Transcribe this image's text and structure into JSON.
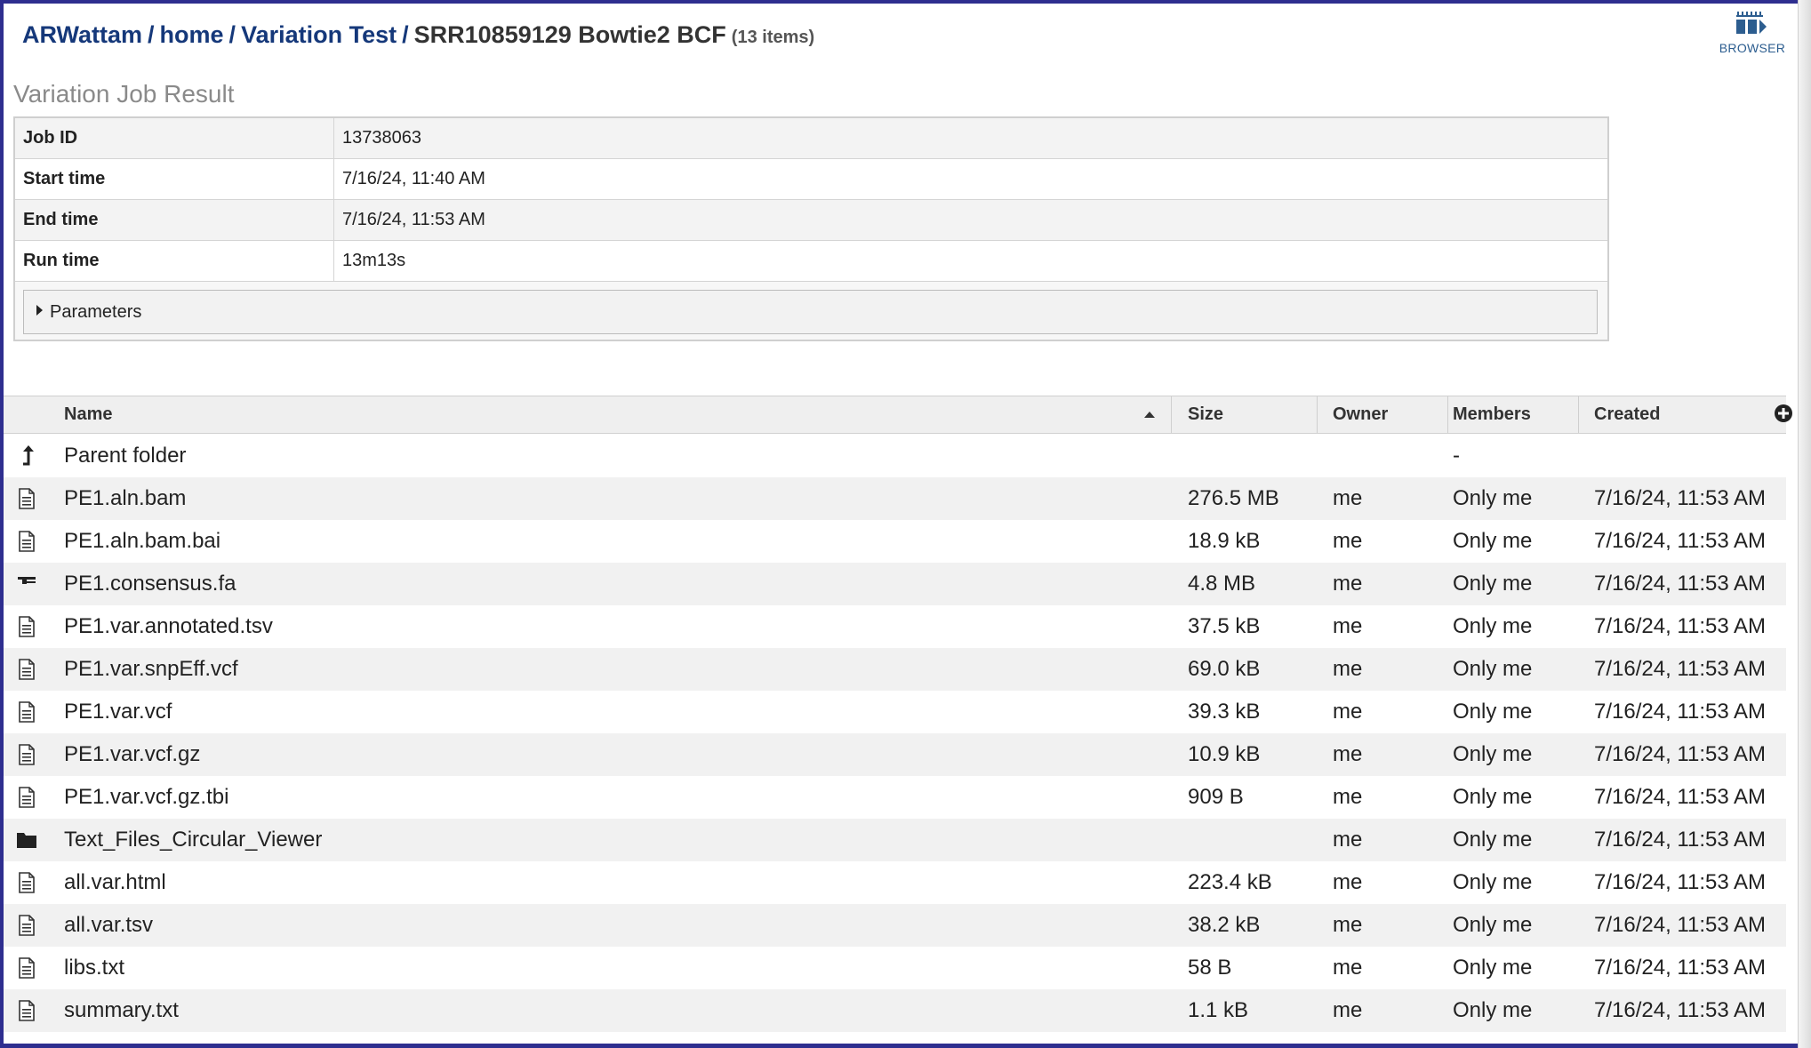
{
  "breadcrumb": {
    "items": [
      "ARWattam",
      "home",
      "Variation Test"
    ],
    "separator": "/",
    "current": "SRR10859129 Bowtie2 BCF",
    "count": "(13 items)"
  },
  "browser_button": {
    "label": "BROWSER",
    "icon": "genome-browser-icon"
  },
  "section_title": "Variation Job Result",
  "job": {
    "rows": [
      {
        "key": "Job ID",
        "value": "13738063"
      },
      {
        "key": "Start time",
        "value": "7/16/24, 11:40 AM"
      },
      {
        "key": "End time",
        "value": "7/16/24, 11:53 AM"
      },
      {
        "key": "Run time",
        "value": "13m13s"
      }
    ],
    "parameters_label": "Parameters"
  },
  "grid": {
    "columns": {
      "name": "Name",
      "size": "Size",
      "owner": "Owner",
      "members": "Members",
      "created": "Created"
    },
    "sort": {
      "column": "Name",
      "direction": "ascending"
    },
    "parent": {
      "name": "Parent folder",
      "members": "-",
      "icon": "parent-folder-icon"
    },
    "files": [
      {
        "icon": "file-icon",
        "name": "PE1.aln.bam",
        "size": "276.5 MB",
        "owner": "me",
        "members": "Only me",
        "created": "7/16/24, 11:53 AM"
      },
      {
        "icon": "file-icon",
        "name": "PE1.aln.bam.bai",
        "size": "18.9 kB",
        "owner": "me",
        "members": "Only me",
        "created": "7/16/24, 11:53 AM"
      },
      {
        "icon": "contigs-icon",
        "name": "PE1.consensus.fa",
        "size": "4.8 MB",
        "owner": "me",
        "members": "Only me",
        "created": "7/16/24, 11:53 AM"
      },
      {
        "icon": "file-icon",
        "name": "PE1.var.annotated.tsv",
        "size": "37.5 kB",
        "owner": "me",
        "members": "Only me",
        "created": "7/16/24, 11:53 AM"
      },
      {
        "icon": "file-icon",
        "name": "PE1.var.snpEff.vcf",
        "size": "69.0 kB",
        "owner": "me",
        "members": "Only me",
        "created": "7/16/24, 11:53 AM"
      },
      {
        "icon": "file-icon",
        "name": "PE1.var.vcf",
        "size": "39.3 kB",
        "owner": "me",
        "members": "Only me",
        "created": "7/16/24, 11:53 AM"
      },
      {
        "icon": "file-icon",
        "name": "PE1.var.vcf.gz",
        "size": "10.9 kB",
        "owner": "me",
        "members": "Only me",
        "created": "7/16/24, 11:53 AM"
      },
      {
        "icon": "file-icon",
        "name": "PE1.var.vcf.gz.tbi",
        "size": "909 B",
        "owner": "me",
        "members": "Only me",
        "created": "7/16/24, 11:53 AM"
      },
      {
        "icon": "folder-icon",
        "name": "Text_Files_Circular_Viewer",
        "size": "",
        "owner": "me",
        "members": "Only me",
        "created": "7/16/24, 11:53 AM"
      },
      {
        "icon": "file-icon",
        "name": "all.var.html",
        "size": "223.4 kB",
        "owner": "me",
        "members": "Only me",
        "created": "7/16/24, 11:53 AM"
      },
      {
        "icon": "file-icon",
        "name": "all.var.tsv",
        "size": "38.2 kB",
        "owner": "me",
        "members": "Only me",
        "created": "7/16/24, 11:53 AM"
      },
      {
        "icon": "file-icon",
        "name": "libs.txt",
        "size": "58 B",
        "owner": "me",
        "members": "Only me",
        "created": "7/16/24, 11:53 AM"
      },
      {
        "icon": "file-icon",
        "name": "summary.txt",
        "size": "1.1 kB",
        "owner": "me",
        "members": "Only me",
        "created": "7/16/24, 11:53 AM"
      }
    ]
  },
  "colors": {
    "frame": "#2e2e8f",
    "link": "#15387a",
    "accent": "#2c5d8f",
    "row_alt": "#f1f1f1"
  }
}
